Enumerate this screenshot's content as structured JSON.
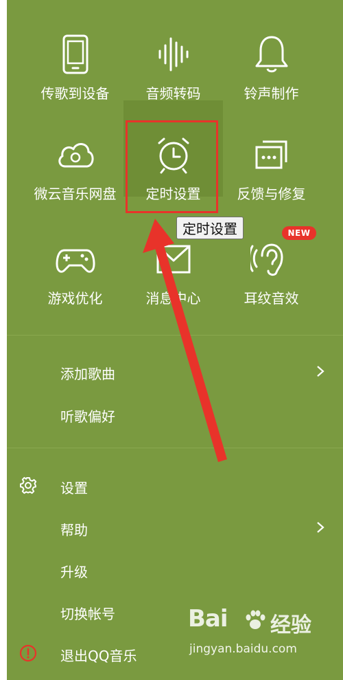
{
  "grid": {
    "tiles": [
      {
        "label": "传歌到设备",
        "icon": "phone-icon"
      },
      {
        "label": "音频转码",
        "icon": "audio-wave-icon"
      },
      {
        "label": "铃声制作",
        "icon": "bell-icon"
      },
      {
        "label": "微云音乐网盘",
        "icon": "cloud-icon"
      },
      {
        "label": "定时设置",
        "icon": "alarm-clock-icon"
      },
      {
        "label": "反馈与修复",
        "icon": "feedback-icon"
      },
      {
        "label": "游戏优化",
        "icon": "gamepad-icon"
      },
      {
        "label": "消息中心",
        "icon": "mail-icon"
      },
      {
        "label": "耳纹音效",
        "icon": "ear-icon"
      }
    ],
    "new_badge": "NEW"
  },
  "tooltip": "定时设置",
  "menu": {
    "section1": [
      {
        "label": "添加歌曲",
        "has_submenu": true
      },
      {
        "label": "听歌偏好",
        "has_submenu": false
      }
    ],
    "section2": [
      {
        "label": "设置",
        "icon": "gear-icon",
        "has_submenu": false
      },
      {
        "label": "帮助",
        "has_submenu": true
      },
      {
        "label": "升级",
        "has_submenu": false
      },
      {
        "label": "切换帐号",
        "has_submenu": false
      },
      {
        "label": "退出QQ音乐",
        "icon": "exit-icon",
        "has_submenu": false
      }
    ]
  },
  "watermark": {
    "brand": "Bai",
    "brand_suffix": "du",
    "cn": "经验",
    "url": "jingyan.baidu.com"
  },
  "colors": {
    "panel_bg": "#7a9a40",
    "highlight_red": "#e8332a",
    "text": "#ffffff"
  }
}
